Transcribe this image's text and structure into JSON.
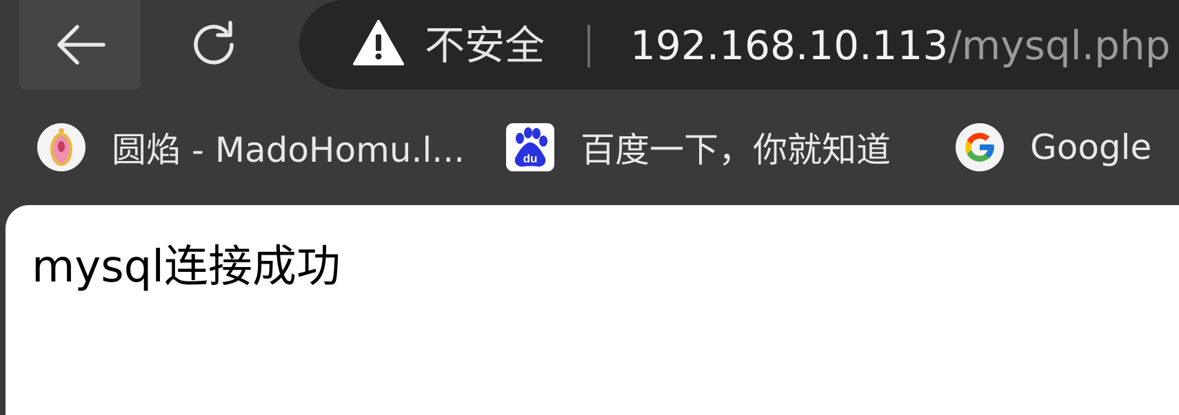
{
  "toolbar": {
    "back_icon": "arrow-left-icon",
    "reload_icon": "reload-icon"
  },
  "omnibox": {
    "security_icon": "warning-icon",
    "security_label": "不安全",
    "url_host": "192.168.10.113",
    "url_path": "/mysql.php"
  },
  "bookmarks": [
    {
      "label": "圆焰 - MadoHomu.l...",
      "icon": "madohomu-favicon"
    },
    {
      "label": "百度一下，你就知道",
      "icon": "baidu-favicon"
    },
    {
      "label": "Google",
      "icon": "google-favicon"
    }
  ],
  "page": {
    "message": "mysql连接成功"
  },
  "colors": {
    "toolbar_bg": "#3a3a3a",
    "omnibox_bg": "#262626",
    "page_bg": "#ffffff",
    "baidu_blue": "#2932e1"
  }
}
